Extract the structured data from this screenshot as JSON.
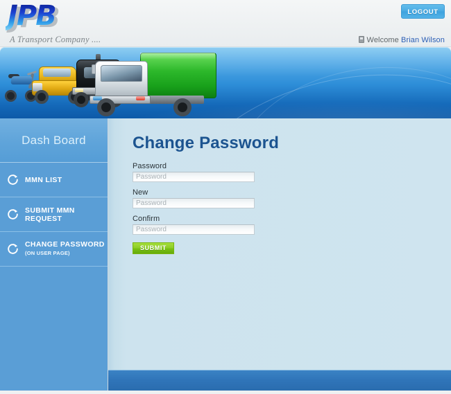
{
  "header": {
    "logo_text": "JPB",
    "tagline": "A Transport Company ....",
    "logout_label": "LOGOUT",
    "welcome_prefix": "Welcome ",
    "user_name": "Brian Wilson",
    "lock_icon": "lock-icon"
  },
  "banner": {
    "vehicles": [
      "motorcycle",
      "yellow-jeep",
      "black-semi-truck",
      "green-box-truck"
    ]
  },
  "sidebar": {
    "title": "Dash Board",
    "items": [
      {
        "label": "MMN LIST",
        "sub": "",
        "icon": "refresh-circle-icon"
      },
      {
        "label": "SUBMIT MMN REQUEST",
        "sub": "",
        "icon": "refresh-circle-icon"
      },
      {
        "label": "CHANGE PASSWORD",
        "sub": "(ON USER PAGE)",
        "icon": "refresh-circle-icon"
      }
    ]
  },
  "main": {
    "page_title": "Change Password",
    "fields": [
      {
        "label": "Password",
        "placeholder": "Password",
        "value": ""
      },
      {
        "label": "New",
        "placeholder": "Password",
        "value": ""
      },
      {
        "label": "Confirm",
        "placeholder": "Password",
        "value": ""
      }
    ],
    "submit_label": "SUBMIT"
  },
  "colors": {
    "brand_blue": "#1c5490",
    "sidebar_blue": "#5a9ed6",
    "content_blue": "#cfe4ef",
    "footer_blue": "#2f74b8",
    "logout_blue": "#4aaae2",
    "submit_green": "#8ece27",
    "link_blue": "#2b5eb5"
  }
}
